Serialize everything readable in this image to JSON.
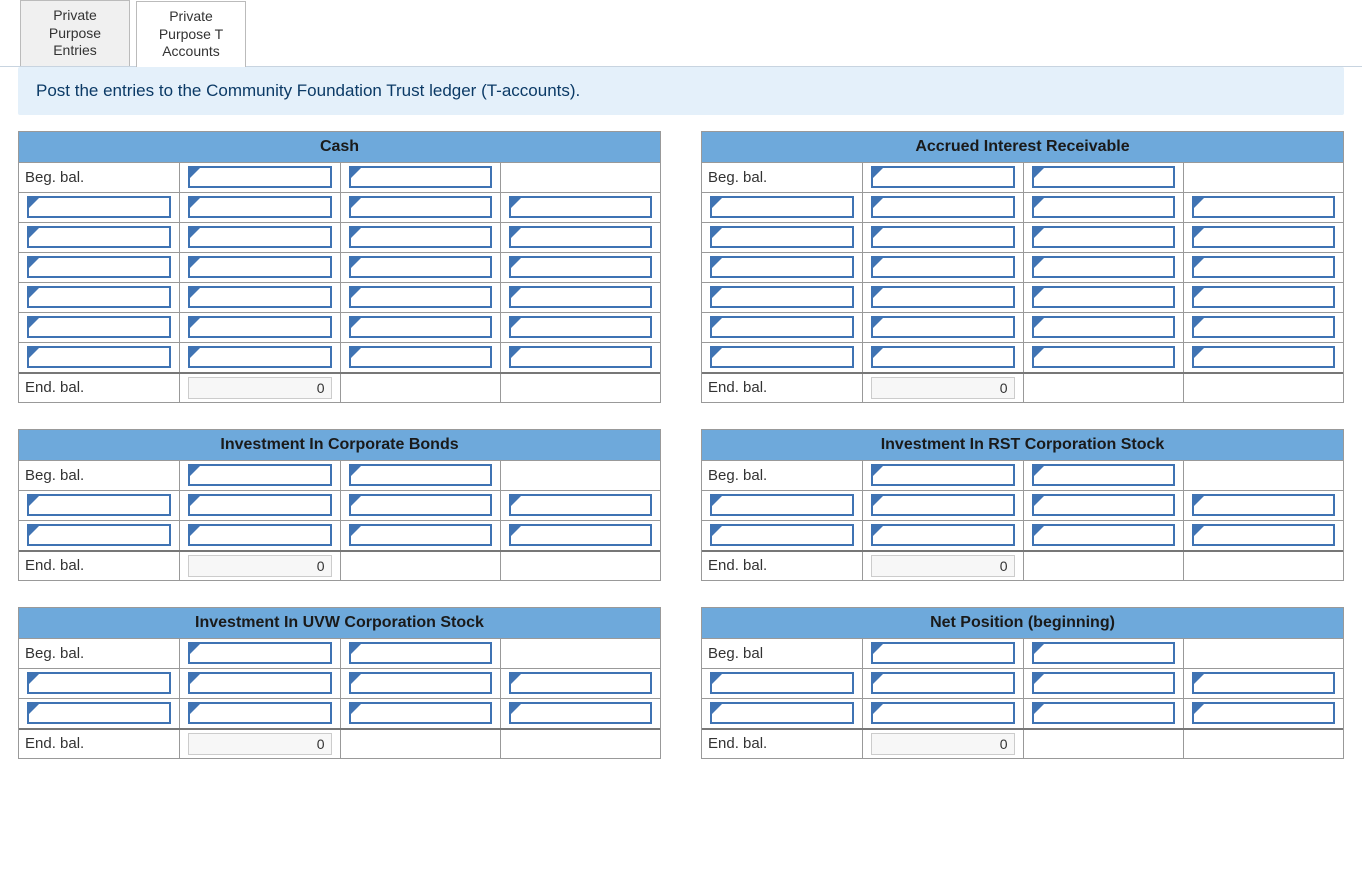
{
  "tabs": [
    {
      "label": "Private\nPurpose\nEntries",
      "active": false
    },
    {
      "label": "Private\nPurpose T\nAccounts",
      "active": true
    }
  ],
  "instruction": "Post the entries to the Community Foundation Trust ledger (T-accounts).",
  "labels": {
    "beg": "Beg. bal.",
    "end": "End. bal.",
    "beg_noperiod": "Beg. bal"
  },
  "accounts": {
    "left": [
      {
        "title": "Cash",
        "body_rows": 6,
        "end_value": "0"
      },
      {
        "title": "Investment In Corporate Bonds",
        "body_rows": 2,
        "end_value": "0"
      },
      {
        "title": "Investment In UVW Corporation Stock",
        "body_rows": 2,
        "end_value": "0"
      }
    ],
    "right": [
      {
        "title": "Accrued Interest Receivable",
        "body_rows": 6,
        "end_value": "0"
      },
      {
        "title": "Investment In RST Corporation Stock",
        "body_rows": 2,
        "end_value": "0"
      },
      {
        "title": "Net Position (beginning)",
        "body_rows": 2,
        "end_value": "0",
        "beg_label_noperiod": true
      }
    ]
  }
}
